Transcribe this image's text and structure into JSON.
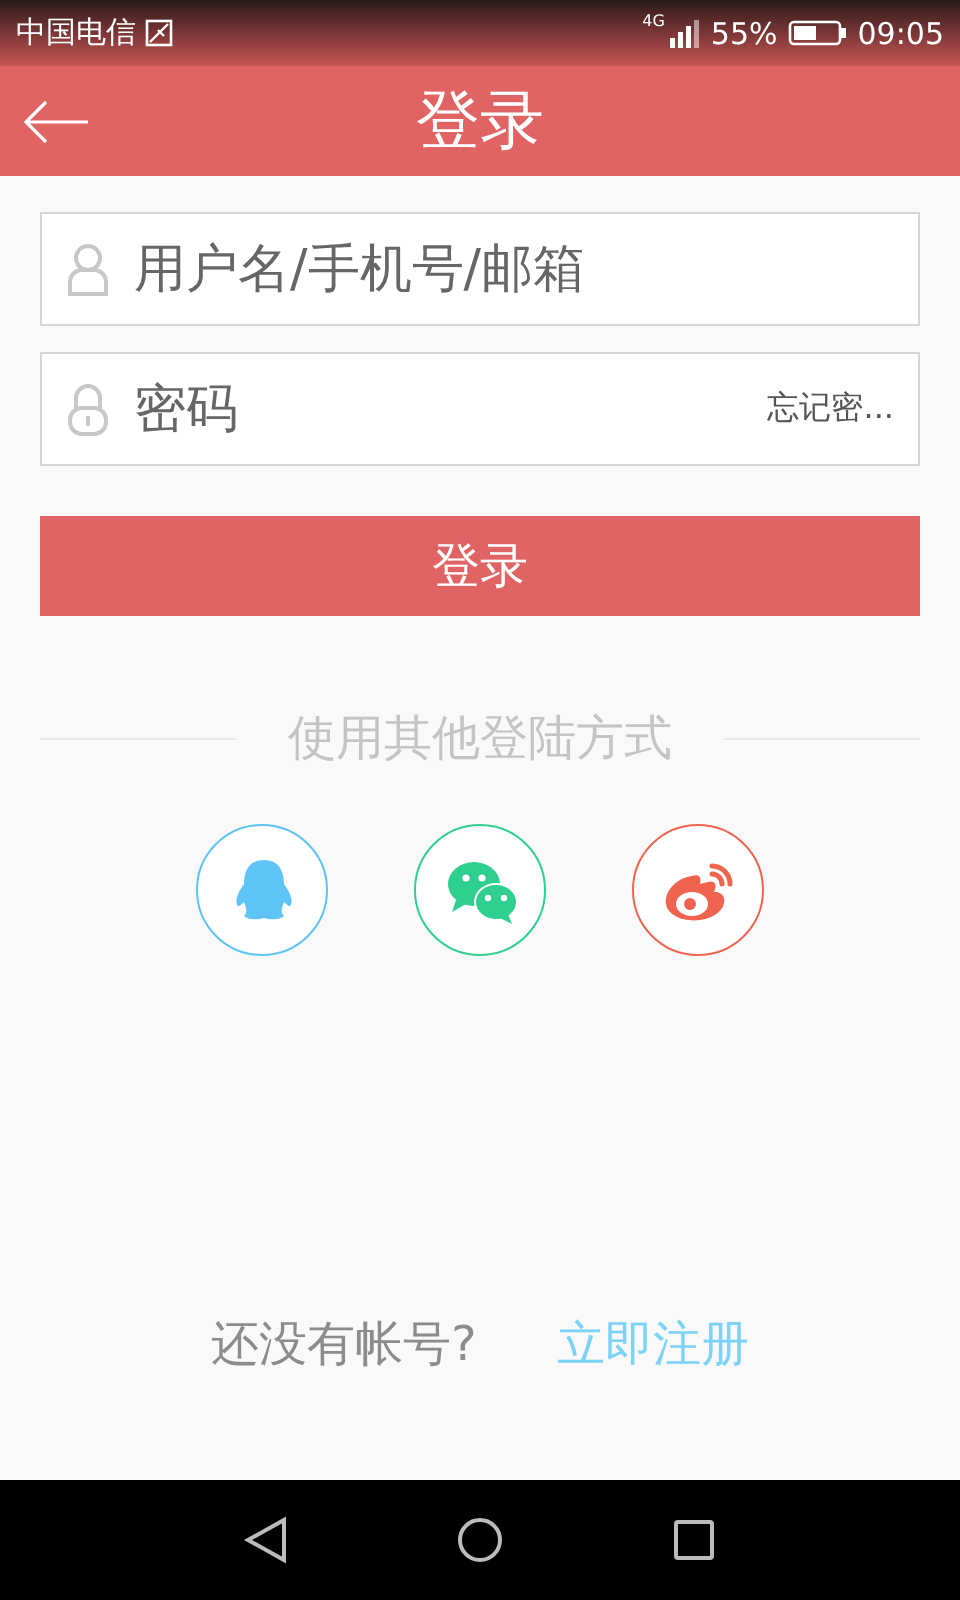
{
  "status_bar": {
    "carrier": "中国电信",
    "network": "4G",
    "battery_text": "55%",
    "time": "09:05"
  },
  "header": {
    "title": "登录"
  },
  "form": {
    "username": {
      "placeholder": "用户名/手机号/邮箱"
    },
    "password": {
      "placeholder": "密码"
    },
    "forgot_link": "忘记密...",
    "submit": "登录"
  },
  "other_login": {
    "title": "使用其他登陆方式",
    "providers": [
      {
        "kind": "qq",
        "color": "#5ec3f5"
      },
      {
        "kind": "wechat",
        "color": "#2fcf8f"
      },
      {
        "kind": "weibo",
        "color": "#f0644f"
      }
    ]
  },
  "register": {
    "prompt": "还没有帐号?",
    "link": "立即注册"
  }
}
